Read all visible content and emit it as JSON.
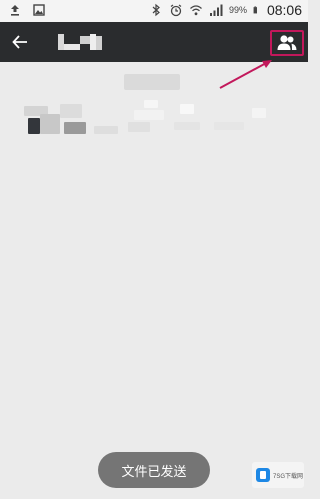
{
  "status_bar": {
    "icons": [
      "upload-icon",
      "image-icon",
      "bluetooth-icon",
      "alarm-icon",
      "wifi-icon",
      "signal-icon"
    ],
    "battery": "99%",
    "time": "08:06"
  },
  "nav": {
    "back_icon": "arrow-left-icon",
    "members_icon": "people-icon",
    "highlight_color": "#c2185b"
  },
  "toast": {
    "text": "文件已发送"
  },
  "watermark": {
    "text": "7SG下载网"
  }
}
